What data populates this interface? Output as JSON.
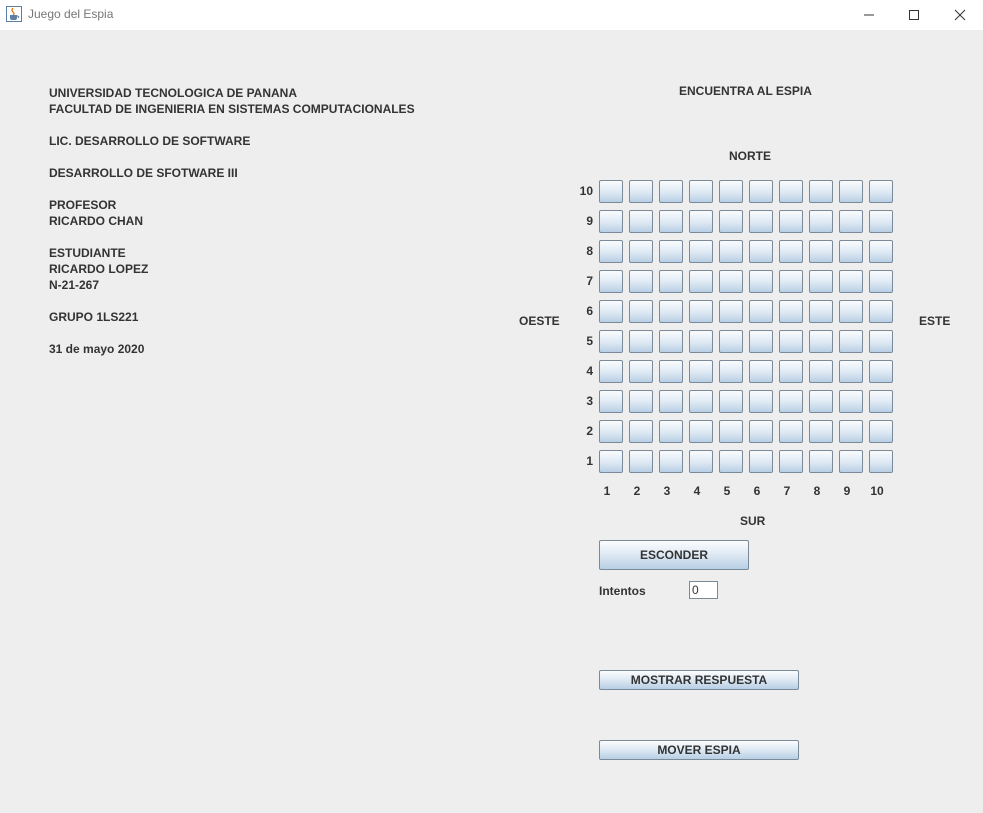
{
  "window": {
    "title": "Juego del Espia",
    "icon": "java-cup-icon",
    "controls": [
      "minimize",
      "maximize",
      "close"
    ]
  },
  "info_lines": [
    "UNIVERSIDAD TECNOLOGICA DE PANANA",
    "FACULTAD DE INGENIERIA EN SISTEMAS COMPUTACIONALES",
    "LIC. DESARROLLO DE SOFTWARE",
    "DESARROLLO DE SFOTWARE III",
    "PROFESOR",
    "RICARDO CHAN",
    "ESTUDIANTE",
    "RICARDO LOPEZ",
    "N-21-267",
    "GRUPO 1LS221",
    "31 de mayo 2020"
  ],
  "game": {
    "heading": "ENCUENTRA AL ESPIA",
    "north": "NORTE",
    "south": "SUR",
    "west": "OESTE",
    "east": "ESTE",
    "row_labels": [
      "10",
      "9",
      "8",
      "7",
      "6",
      "5",
      "4",
      "3",
      "2",
      "1"
    ],
    "col_labels": [
      "1",
      "2",
      "3",
      "4",
      "5",
      "6",
      "7",
      "8",
      "9",
      "10"
    ]
  },
  "controls": {
    "hide_button": "ESCONDER",
    "attempts_label": "Intentos",
    "attempts_value": "0",
    "show_answer_button": "MOSTRAR RESPUESTA",
    "move_spy_button": "MOVER ESPIA"
  }
}
